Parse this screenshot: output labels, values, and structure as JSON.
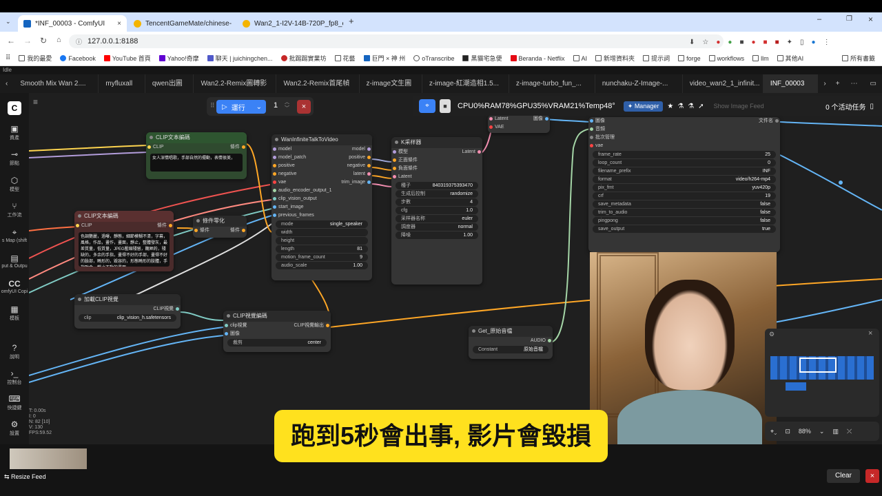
{
  "browser": {
    "tabs": [
      {
        "title": "*INF_00003 - ComfyUI",
        "color": "#1565c0"
      },
      {
        "title": "TencentGameMate/chinese-",
        "color": "#f4b400"
      },
      {
        "title": "Wan2_1-I2V-14B-720P_fp8_e",
        "color": "#f4b400"
      }
    ],
    "url": "127.0.0.1:8188",
    "bookmarks": [
      "我的最愛",
      "Facebook",
      "YouTube 首頁",
      "Yahoo!奇摩",
      "聊天 | juichingchen...",
      "批踢踢實業坊",
      "花藝",
      "巨門 × 神 州",
      "oTranscribe",
      "黑貓宅急便",
      "Beranda - Netflix",
      "AI",
      "新增資料夾",
      "提示詞",
      "forge",
      "workflows",
      "llm",
      "其他AI",
      "所有書籤"
    ]
  },
  "comfy": {
    "status_word": "Idle",
    "workflow_tabs": [
      "Smooth Mix Wan 2....",
      "myfluxall",
      "qwen出圖",
      "Wan2.2-Remix圖轉影",
      "Wan2.2-Remix首尾幀",
      "z-image文生圖",
      "z-image-紅潮造相1.5...",
      "z-image-turbo_fun_...",
      "nunchaku-Z-Image-...",
      "video_wan2_1_infinit...",
      "INF_00003"
    ],
    "sidebar": [
      "資產",
      "節點",
      "模型",
      "工作流",
      "s Map (shift",
      "put & Outpu",
      "omfyUI Copi",
      "模板",
      "說明",
      "控制台",
      "快捷鍵",
      "設置"
    ],
    "run": {
      "label": "運行",
      "count": "1"
    },
    "stats": "CPU0%RAM78%GPU35%VRAM21%Temp48°",
    "manager": "Manager",
    "show_feed": "Show Image Feed",
    "active_tasks": "0 个活动任务",
    "debug": [
      "T: 0.00s",
      "I: 0",
      "N: 82 [10]",
      "V: 130",
      "FPS:59.52"
    ],
    "zoom": "88%",
    "resize_feed": "Resize Feed",
    "clear": "Clear"
  },
  "nodes": {
    "clip_text1": {
      "title": "CLIP文本編碼",
      "in": "CLIP",
      "out": "條件",
      "text": "女人深情唱歌，手部自然的擺動，表情很美，"
    },
    "clip_text2": {
      "title": "CLIP文本編碼",
      "in": "CLIP",
      "out": "條件",
      "text": "色調艷麗，過曝，靜態，細節模糊不清，字幕，風格，作品，畫作，畫面，靜止，整體發灰，最差質量，低質量，JPEG壓縮殘留，醜陋的，殘缺的，多余的手指，畫得不好的手部，畫得不好的臉部，畸形的，毀容的，形態畸形的肢體，手指融合，靜止不動的畫面"
    },
    "cond_zero": {
      "title": "條件零化",
      "in": "條件",
      "out": "條件"
    },
    "load_clip": {
      "title": "加載CLIP視覺",
      "out": "CLIP視覺",
      "widget_label": "clip",
      "widget_value": "clip_vision_h.safetensors"
    },
    "clip_vis_enc": {
      "title": "CLIP視覺編碼",
      "in1": "clip視覺",
      "in2": "圖像",
      "out": "CLIP視覺輸出",
      "w_label": "裁剪",
      "w_value": "center"
    },
    "wan": {
      "title": "WanInfiniteTalkToVideo",
      "inputs": [
        "model",
        "model_patch",
        "positive",
        "negative",
        "vae",
        "audio_encoder_output_1",
        "clip_vision_output",
        "start_image",
        "previous_frames"
      ],
      "outputs": [
        "model",
        "positive",
        "negative",
        "latent",
        "trim_image"
      ],
      "widgets": [
        [
          "mode",
          "single_speaker"
        ],
        [
          "width",
          ""
        ],
        [
          "height",
          ""
        ],
        [
          "length",
          "81"
        ],
        [
          "motion_frame_count",
          "9"
        ],
        [
          "audio_scale",
          "1.00"
        ]
      ]
    },
    "ksampler": {
      "title": "K采样器",
      "inputs": [
        "模型",
        "正面條件",
        "負面條件",
        "Latent"
      ],
      "out": "Latent",
      "widgets": [
        [
          "種子",
          "840319375393470"
        ],
        [
          "生成后控制",
          "randomize"
        ],
        [
          "步數",
          "4"
        ],
        [
          "cfg",
          "1.0"
        ],
        [
          "采样器名称",
          "euler"
        ],
        [
          "調度器",
          "normal"
        ],
        [
          "降噪",
          "1.00"
        ]
      ]
    },
    "decode": {
      "in1": "Latent",
      "in2": "VAE",
      "out": "圖像"
    },
    "get_audio": {
      "title": "Get_原始音檔",
      "out": "AUDIO",
      "w_label": "Constant",
      "w_value": "原始音檔"
    },
    "video": {
      "inputs": [
        "圖像",
        "音頻",
        "批次管理",
        "vae"
      ],
      "out": "文件名",
      "widgets": [
        [
          "frame_rate",
          "25"
        ],
        [
          "loop_count",
          "0"
        ],
        [
          "filename_prefix",
          "INF"
        ],
        [
          "format",
          "video/h264-mp4"
        ],
        [
          "pix_fmt",
          "yuv420p"
        ],
        [
          "crf",
          "19"
        ],
        [
          "save_metadata",
          "false"
        ],
        [
          "trim_to_audio",
          "false"
        ],
        [
          "pingpong",
          "false"
        ],
        [
          "save_output",
          "true"
        ]
      ]
    }
  },
  "subtitle": "跑到5秒會出事, 影片會毀損"
}
